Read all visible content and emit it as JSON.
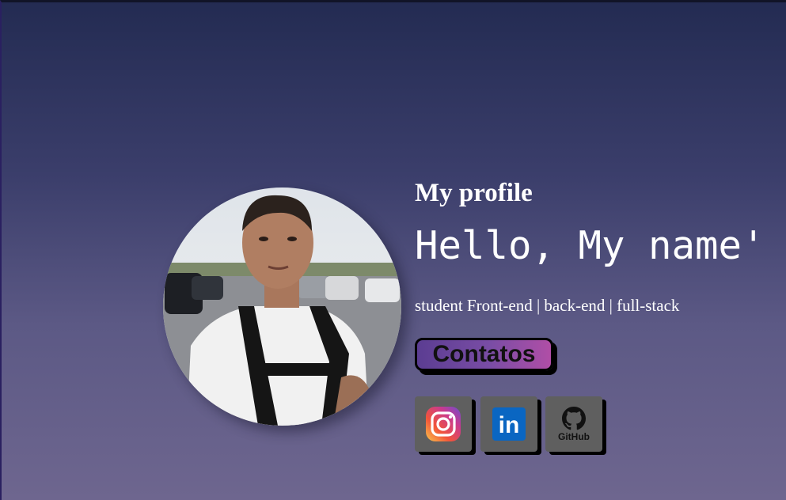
{
  "profile": {
    "title": "My profile",
    "greeting": "Hello, My name'",
    "roles": "student Front-end | back-end | full-stack",
    "contact_button": "Contatos"
  },
  "social": [
    {
      "name": "Instagram",
      "icon": "instagram-icon"
    },
    {
      "name": "LinkedIn",
      "icon": "linkedin-icon",
      "label": "in"
    },
    {
      "name": "GitHub",
      "icon": "github-icon",
      "label": "GitHub"
    }
  ],
  "colors": {
    "bg_top": "#232b52",
    "bg_bottom": "#6e668f",
    "button_gradient_start": "#5b3d92",
    "button_gradient_end": "#b04ea6",
    "social_tile": "#5f5f5f",
    "linkedin_blue": "#0a66c2"
  }
}
